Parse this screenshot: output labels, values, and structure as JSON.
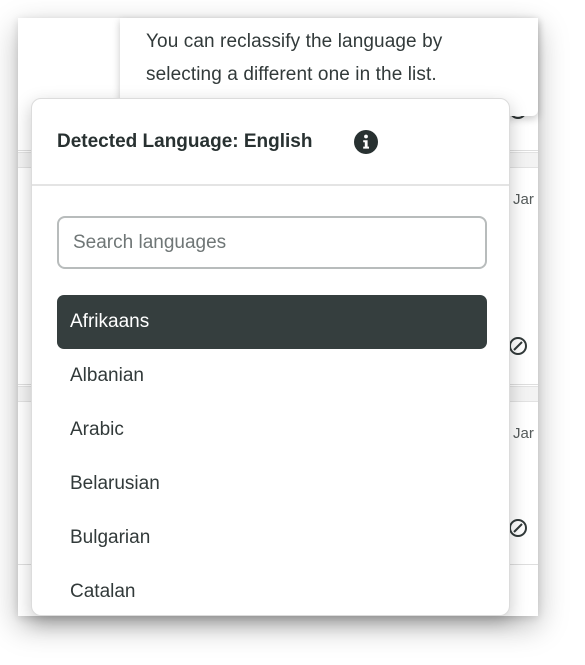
{
  "tooltip": {
    "text": "You can reclassify the language by selecting a different one in the list."
  },
  "background": {
    "row_dates": [
      "Jar",
      "Jar"
    ]
  },
  "language_dropdown": {
    "title": "Detected Language: English",
    "info_icon": "info-circle-icon",
    "search": {
      "placeholder": "Search languages",
      "value": ""
    },
    "languages": [
      {
        "label": "Afrikaans",
        "selected": true
      },
      {
        "label": "Albanian",
        "selected": false
      },
      {
        "label": "Arabic",
        "selected": false
      },
      {
        "label": "Belarusian",
        "selected": false
      },
      {
        "label": "Bulgarian",
        "selected": false
      },
      {
        "label": "Catalan",
        "selected": false
      }
    ]
  },
  "colors": {
    "selected_bg": "#353e3e",
    "text": "#323a3a"
  }
}
